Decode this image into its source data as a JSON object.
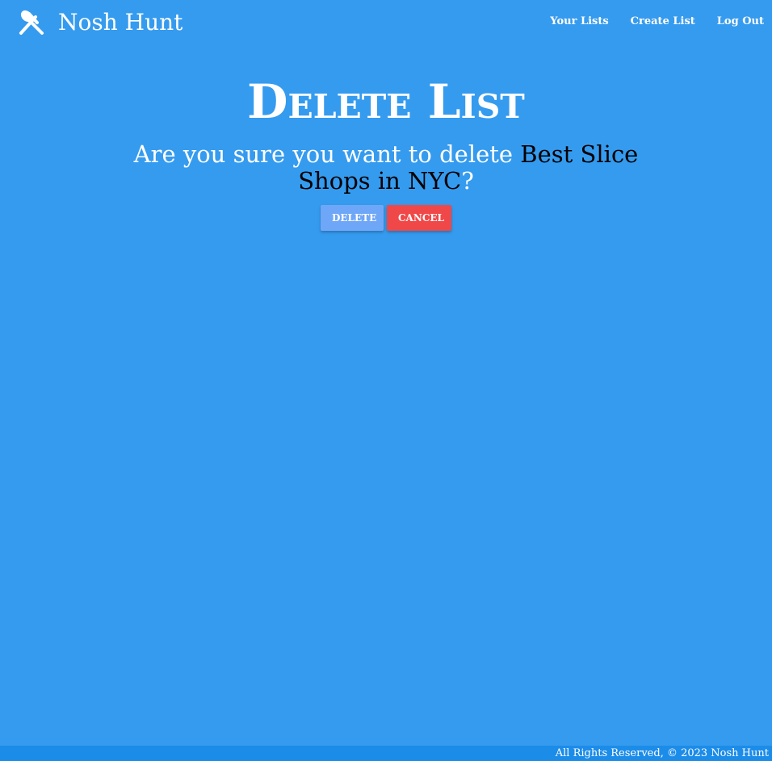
{
  "app": {
    "name": "Nosh Hunt",
    "logo_icon": "fork-spoon-icon"
  },
  "nav": {
    "links": [
      "Your Lists",
      "Create List",
      "Log Out"
    ]
  },
  "page": {
    "title": "Delete List",
    "confirm_prefix": "Are you sure you want to delete ",
    "list_name": "Best Slice Shops in NYC",
    "confirm_suffix": "?"
  },
  "actions": {
    "delete_label": "Delete",
    "cancel_label": "Cancel"
  },
  "footer": {
    "text": "All Rights Reserved, © 2023 Nosh Hunt"
  },
  "colors": {
    "background": "#359bef",
    "footer": "#1c8ce9",
    "delete_button": "#6fa7f8",
    "cancel_button": "#f04848",
    "list_name": "#000000"
  }
}
